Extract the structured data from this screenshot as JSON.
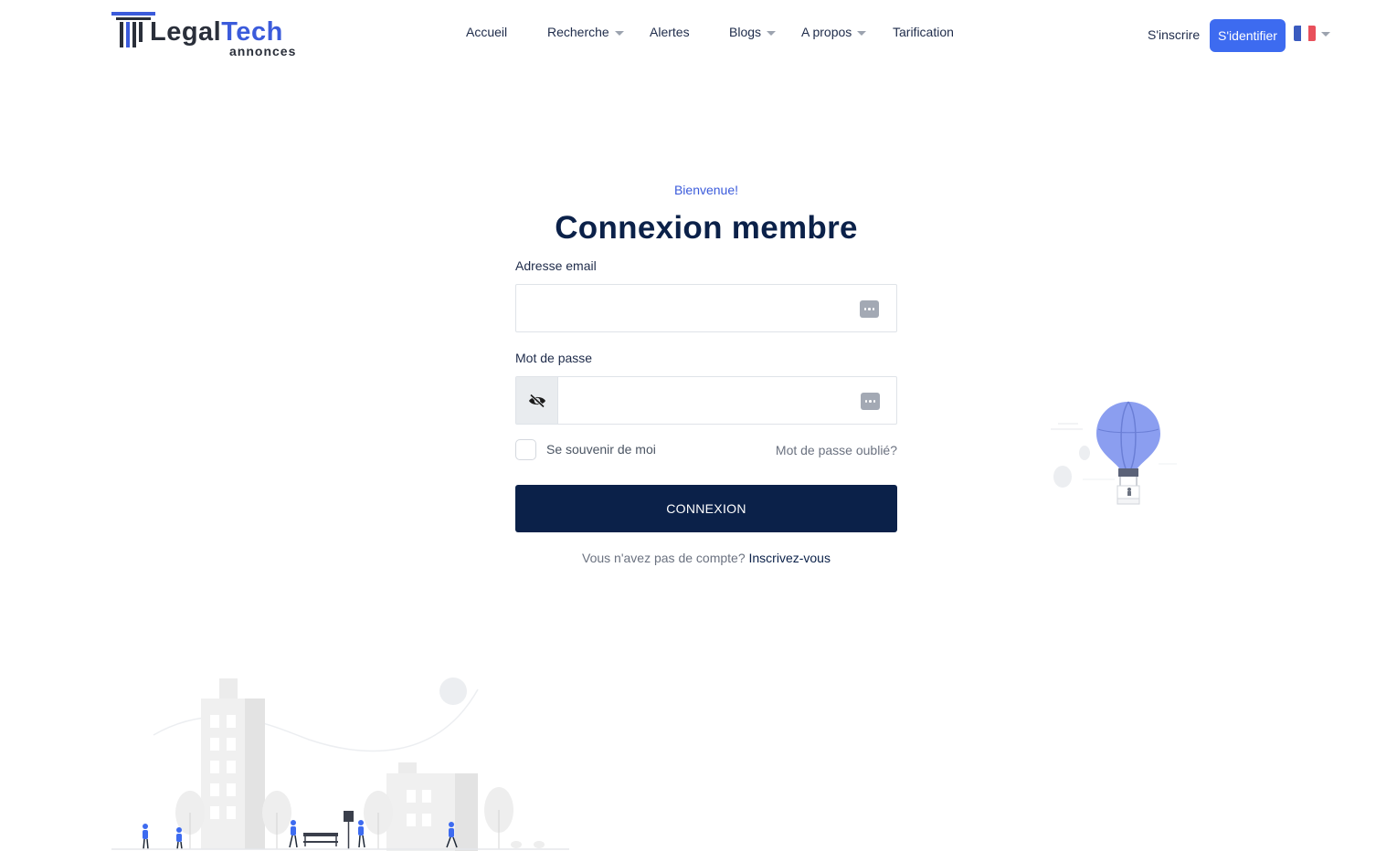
{
  "brand": {
    "name_part1": "Legal",
    "name_part2": "Tech",
    "tagline": "annonces"
  },
  "nav": [
    {
      "label": "Accueil",
      "dropdown": false
    },
    {
      "label": "Recherche",
      "dropdown": true
    },
    {
      "label": "Alertes",
      "dropdown": false
    },
    {
      "label": "Blogs",
      "dropdown": true
    },
    {
      "label": "A propos",
      "dropdown": true
    },
    {
      "label": "Tarification",
      "dropdown": false
    }
  ],
  "header_actions": {
    "signup_label": "S'inscrire",
    "signin_label": "S'identifier",
    "language": "fr"
  },
  "login": {
    "welcome": "Bienvenue!",
    "title": "Connexion membre",
    "email_label": "Adresse email",
    "email_value": "",
    "password_label": "Mot de passe",
    "password_value": "",
    "remember_label": "Se souvenir de moi",
    "remember_checked": false,
    "forgot_label": "Mot de passe oublié?",
    "submit_label": "CONNEXION",
    "no_account_text": "Vous n'avez pas de compte?",
    "register_link": "Inscrivez-vous"
  },
  "colors": {
    "primary_blue": "#3d6bf0",
    "navy": "#0b2149",
    "accent_blue": "#3b5bdb",
    "balloon": "#8b9ef0",
    "flag_blue": "#3a5bbf",
    "flag_white": "#ffffff",
    "flag_red": "#e8505b"
  },
  "icons": {
    "field_icon": "password-manager-icon",
    "eye_toggle": "eye-off-icon",
    "language": "france-flag-icon"
  }
}
